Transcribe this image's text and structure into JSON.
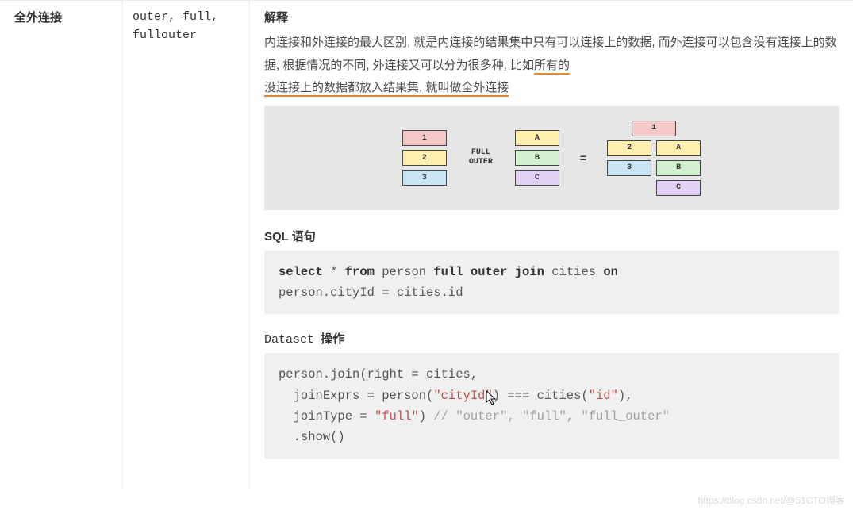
{
  "row": {
    "label": "全外连接",
    "keywords": "outer, full, fullouter"
  },
  "desc": {
    "title": "解释",
    "line1_a": "内连接和外连接的最大区别, 就是内连接的结果集中只有可以连接上的数据, 而外连接可以包含没有连接上的数据, 根据情况的不同, 外连接又可以分为很多种, 比如",
    "line1_u1": "所有的",
    "line2_u": "没连接上的数据都放入结果集, 就叫做全外连接"
  },
  "diagram": {
    "left": [
      "1",
      "2",
      "3"
    ],
    "op_line1": "FULL",
    "op_line2": "OUTER",
    "right": [
      "A",
      "B",
      "C"
    ],
    "eq": "=",
    "result_left": [
      "1",
      "2",
      "3",
      ""
    ],
    "result_right": [
      "",
      "A",
      "B",
      "C"
    ]
  },
  "sql": {
    "title": "SQL 语句",
    "kw_select": "select",
    "star": " * ",
    "kw_from": "from",
    "t1": " person ",
    "kw_full": "full",
    "sp": " ",
    "kw_outer": "outer",
    "kw_join": "join",
    "t2": " cities ",
    "kw_on": "on",
    "line2": "person.cityId = cities.id"
  },
  "ds": {
    "title_mono": "Dataset",
    "title_rest": " 操作",
    "l1": "person.join(right = cities,",
    "l2a": "  joinExprs = person(",
    "l2s1": "\"cityId\"",
    "l2b": ") === cities(",
    "l2s2": "\"id\"",
    "l2c": "),",
    "l3a": "  joinType = ",
    "l3s": "\"full\"",
    "l3b": ") ",
    "l3cmt": "// \"outer\", \"full\", \"full_outer\"",
    "l4": "  .show()"
  },
  "watermark": "https://blog.csdn.net/@51CTO博客"
}
